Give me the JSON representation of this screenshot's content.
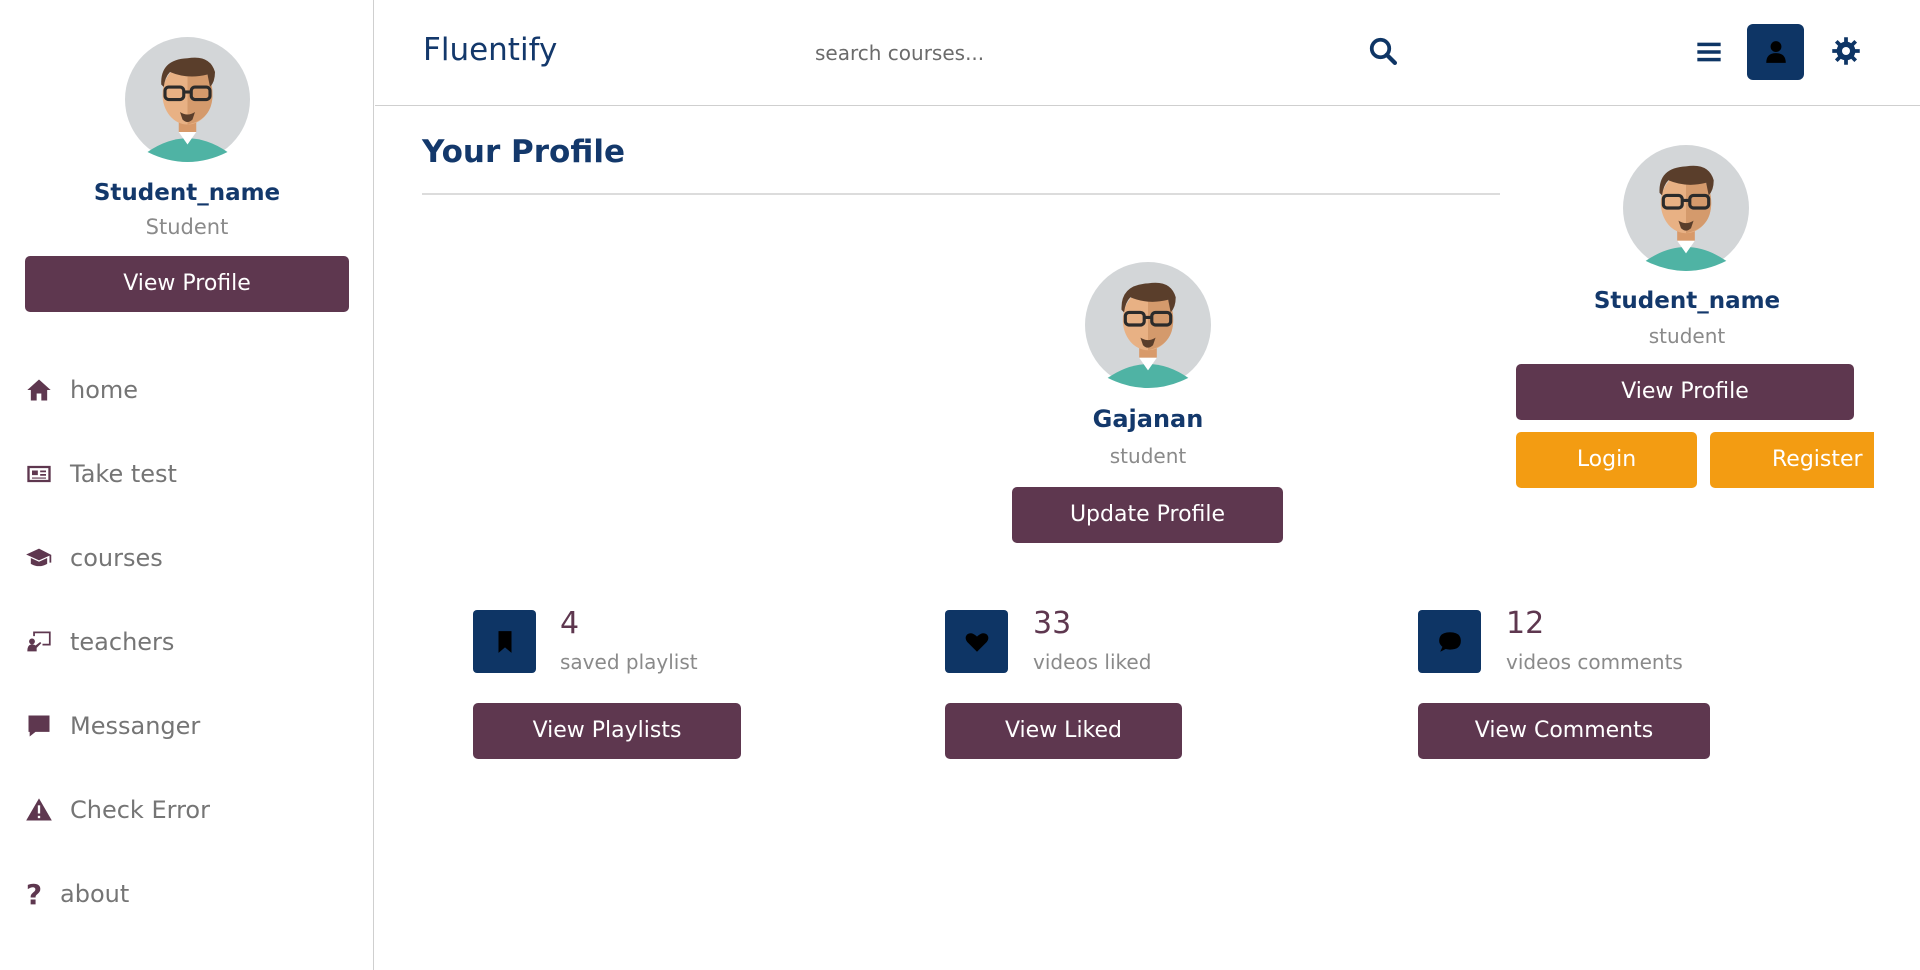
{
  "sidebar": {
    "user_name": "Student_name",
    "user_role": "Student",
    "view_profile_label": "View Profile",
    "nav": [
      {
        "label": "home",
        "icon": "home-icon"
      },
      {
        "label": "Take test",
        "icon": "newspaper-icon"
      },
      {
        "label": "courses",
        "icon": "graduation-cap-icon"
      },
      {
        "label": "teachers",
        "icon": "chalkboard-teacher-icon"
      },
      {
        "label": "Messanger",
        "icon": "message-icon"
      },
      {
        "label": "Check Error",
        "icon": "warning-icon"
      },
      {
        "label": "about",
        "icon": "question-icon"
      }
    ]
  },
  "header": {
    "brand": "Fluentify",
    "search_placeholder": "search courses...",
    "icons": [
      "search-icon",
      "menu-icon",
      "user-icon",
      "gear-icon"
    ]
  },
  "main": {
    "page_title": "Your Profile",
    "profile": {
      "name": "Gajanan",
      "role": "student",
      "update_label": "Update Profile"
    },
    "stats": [
      {
        "value": "4",
        "label": "saved playlist",
        "button": "View Playlists",
        "icon": "bookmark-icon"
      },
      {
        "value": "33",
        "label": "videos liked",
        "button": "View Liked",
        "icon": "heart-icon"
      },
      {
        "value": "12",
        "label": "videos comments",
        "button": "View Comments",
        "icon": "comment-icon"
      }
    ]
  },
  "popup": {
    "name": "Student_name",
    "role": "student",
    "view_profile_label": "View Profile",
    "login_label": "Login",
    "register_label": "Register"
  },
  "colors": {
    "primary_navy": "#0e3565",
    "heading_blue": "#13386b",
    "button_plum": "#5e374f",
    "accent_orange": "#f39c12",
    "muted_text": "#8a8a8a"
  }
}
